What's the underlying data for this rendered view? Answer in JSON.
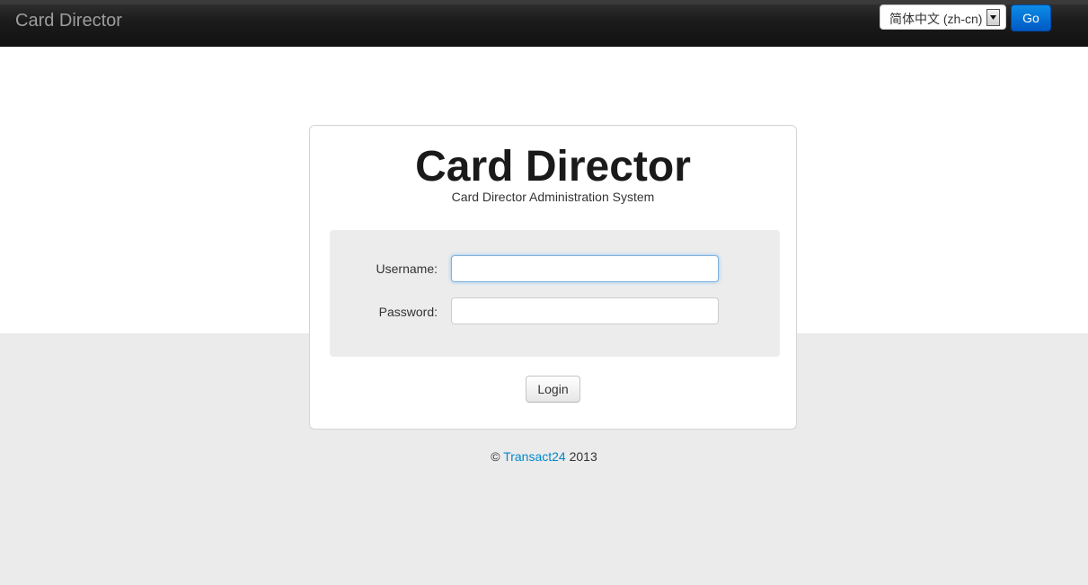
{
  "navbar": {
    "brand": "Card Director",
    "language_select": {
      "selected": "简体中文 (zh-cn)"
    },
    "go_label": "Go"
  },
  "login": {
    "title": "Card Director",
    "subtitle": "Card Director Administration System",
    "username_label": "Username:",
    "username_value": "",
    "password_label": "Password:",
    "password_value": "",
    "login_label": "Login"
  },
  "footer": {
    "copyright_symbol": "©",
    "company_link": "Transact24",
    "year": "2013"
  },
  "colors": {
    "navbar_bg": "#1b1b1b",
    "brand_text": "#9d9d9d",
    "go_button": "#0a6fd6",
    "link": "#0088cc",
    "page_lower_bg": "#ebebeb",
    "form_well_bg": "#ececec"
  }
}
